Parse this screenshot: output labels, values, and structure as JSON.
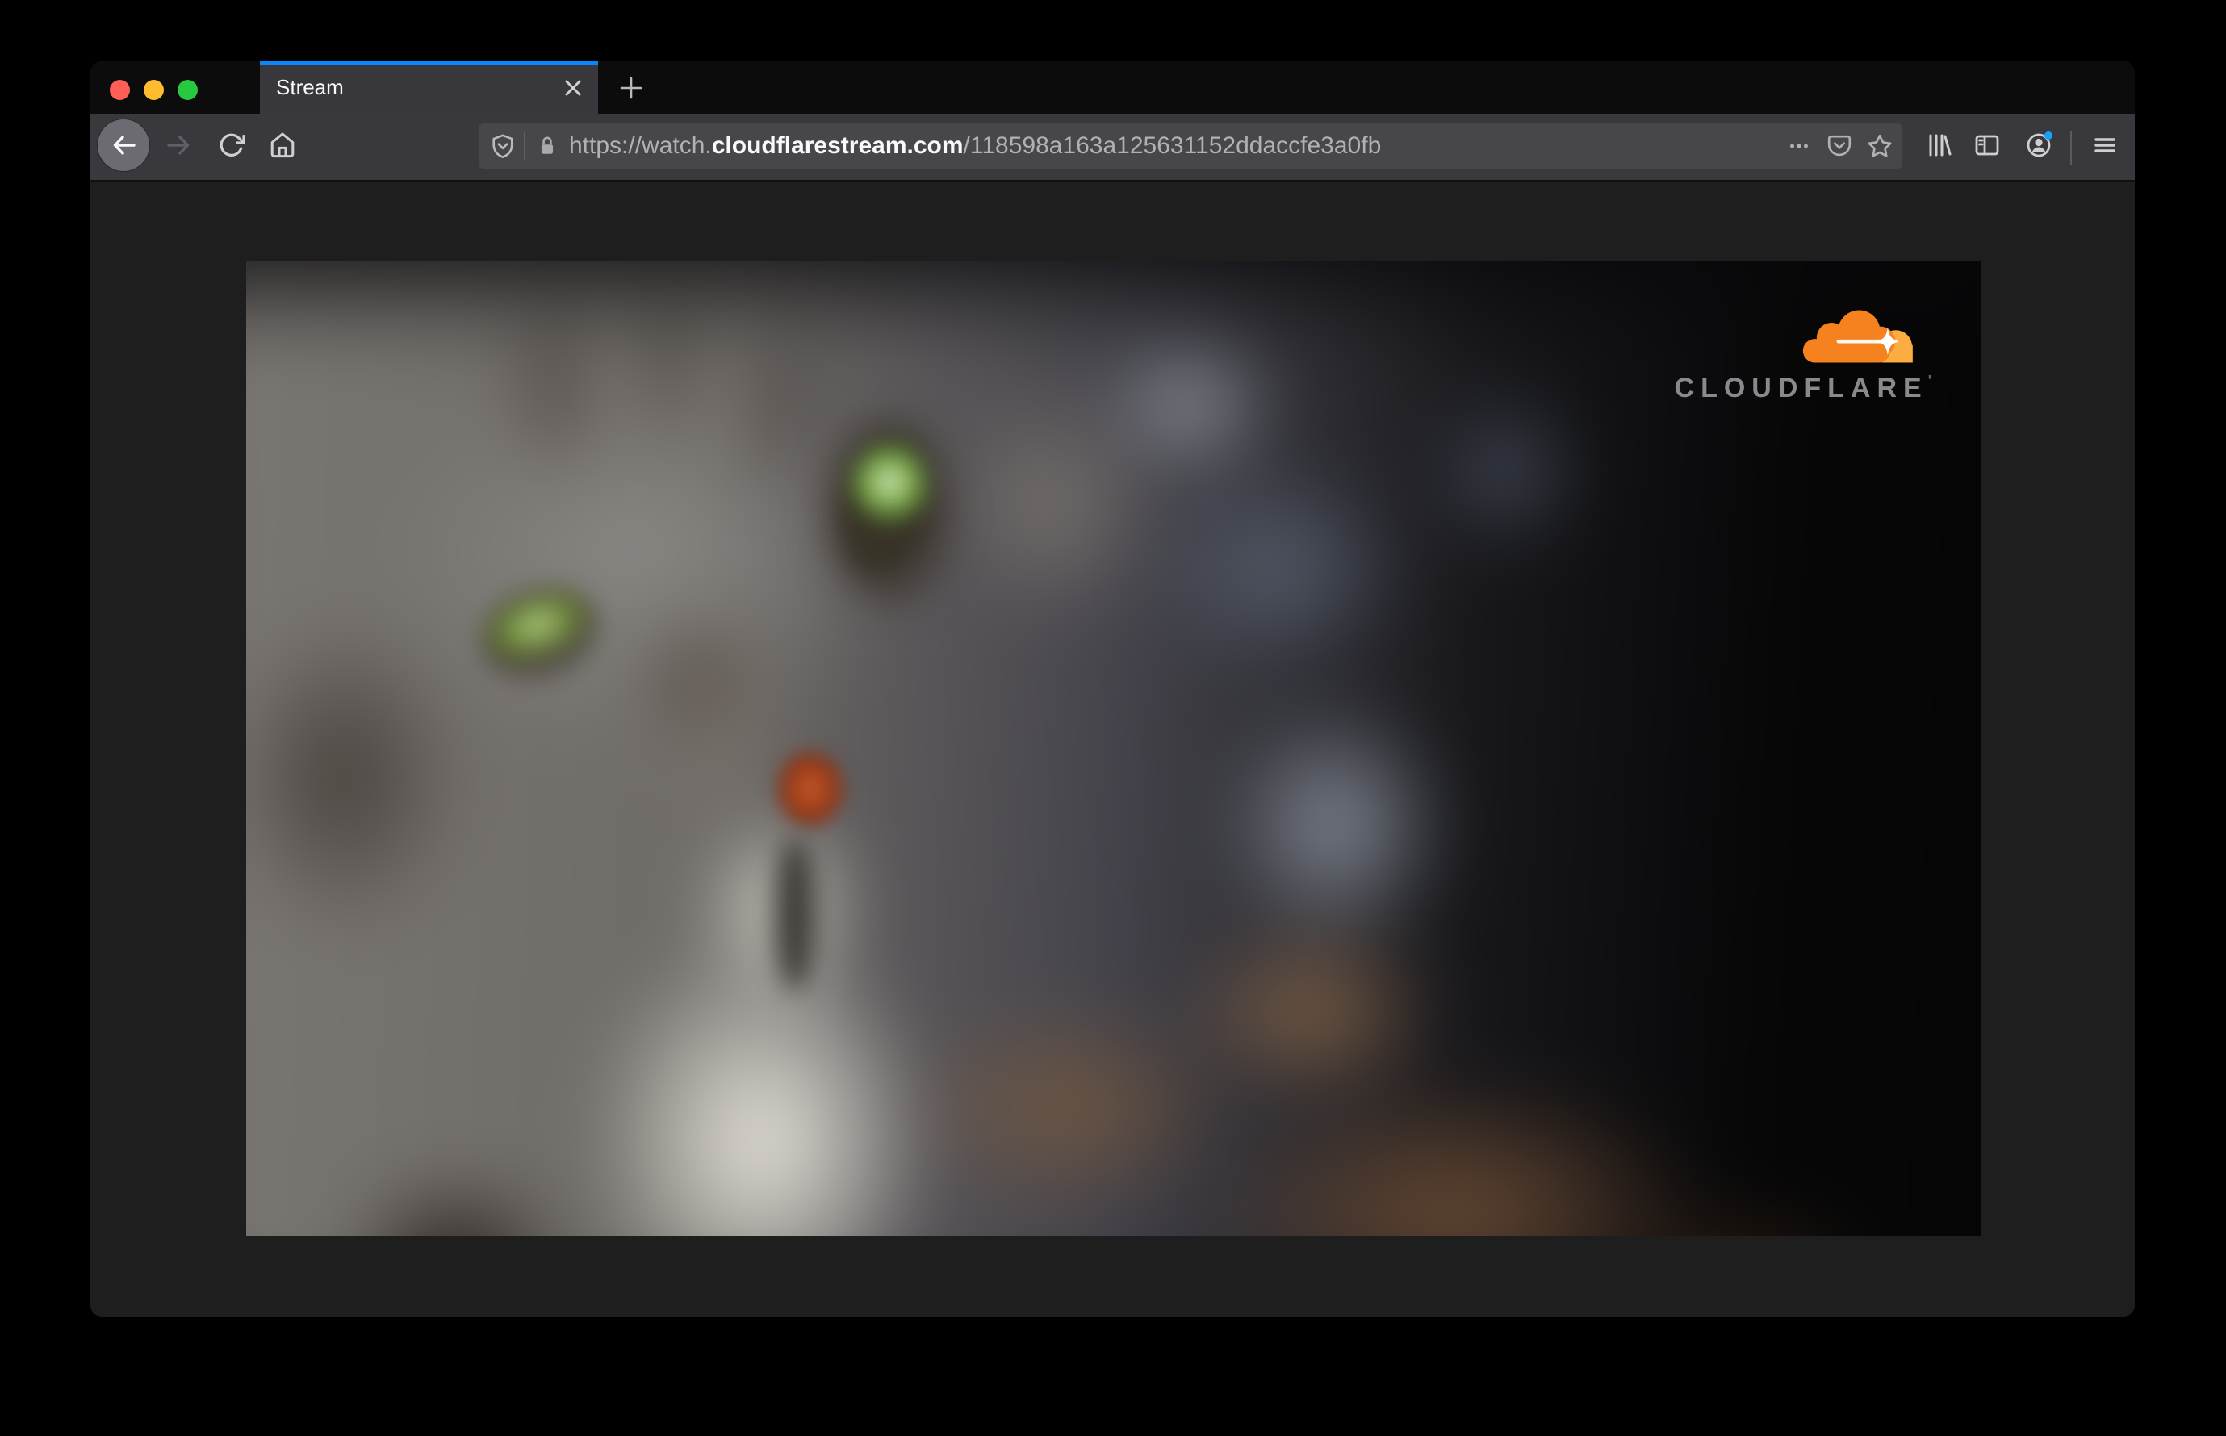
{
  "window": {
    "controls": [
      {
        "name": "close",
        "color": "#ff5f57"
      },
      {
        "name": "minimize",
        "color": "#febc2e"
      },
      {
        "name": "zoom",
        "color": "#28c840"
      }
    ]
  },
  "tab_bar": {
    "active_tab": {
      "title": "Stream"
    },
    "tab_accent_color": "#0a84ff"
  },
  "navbar": {
    "buttons": [
      "back",
      "forward",
      "reload",
      "home",
      "library",
      "sidebar",
      "account",
      "menu"
    ],
    "url_bar": {
      "url_prefix": "https://watch.",
      "url_domain": "cloudflarestream.com",
      "url_path": "/118598a163a125631152ddaccfe3a0fb",
      "left_icons": [
        "tracking-protection-shield",
        "lock"
      ],
      "right_icons": [
        "page-actions-ellipsis",
        "pocket",
        "bookmark-star"
      ]
    },
    "account_notification_dot": "#18a0fb"
  },
  "video_player": {
    "watermark": {
      "brand": "CLOUDFLARE",
      "trademark": "'",
      "logo_colors": {
        "cloud": "#f6821f",
        "sun_lobe": "#fbad41",
        "sparkle": "#ffffff"
      }
    },
    "scene": "blurred close-up of a gray tabby cat with green eyes, white chest, rust nose"
  },
  "colors": {
    "titlebar_bg": "#0c0c0d",
    "toolbar_bg": "#38383d",
    "urlbar_bg": "#474749",
    "content_bg": "#1e1e1f",
    "text_bright": "#f9f9fa",
    "text_dim": "#b1b1b3"
  }
}
